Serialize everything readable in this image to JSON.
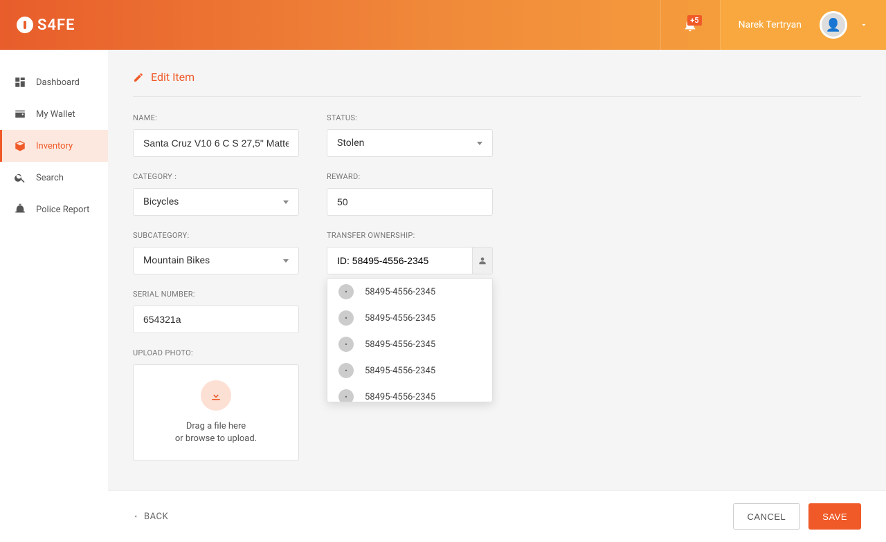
{
  "brand": "S4FE",
  "notif_badge": "+5",
  "user": {
    "name": "Narek Tertryan"
  },
  "sidebar": {
    "items": [
      {
        "label": "Dashboard",
        "icon": "dashboard"
      },
      {
        "label": "My Wallet",
        "icon": "wallet"
      },
      {
        "label": "Inventory",
        "icon": "inventory",
        "active": true
      },
      {
        "label": "Search",
        "icon": "search"
      },
      {
        "label": "Police Report",
        "icon": "police"
      }
    ]
  },
  "page": {
    "title": "Edit Item"
  },
  "form": {
    "name_label": "NAME:",
    "name_value": "Santa Cruz V10 6 C S 27,5\" Matte",
    "category_label": "CATEGORY :",
    "category_value": "Bicycles",
    "subcategory_label": "SUBCATEGORY:",
    "subcategory_value": "Mountain Bikes",
    "serial_label": "SERIAL NUMBER:",
    "serial_value": "654321a",
    "upload_label": "UPLOAD PHOTO:",
    "upload_text1": "Drag a file here",
    "upload_text2": "or browse to upload.",
    "status_label": "STATUS:",
    "status_value": "Stolen",
    "reward_label": "REWARD:",
    "reward_value": "50",
    "transfer_label": "TRANSFER OWNERSHIP:",
    "transfer_value": "ID: 58495-4556-2345",
    "transfer_options": [
      "58495-4556-2345",
      "58495-4556-2345",
      "58495-4556-2345",
      "58495-4556-2345",
      "58495-4556-2345"
    ]
  },
  "footer": {
    "back": "BACK",
    "cancel": "CANCEL",
    "save": "SAVE"
  }
}
